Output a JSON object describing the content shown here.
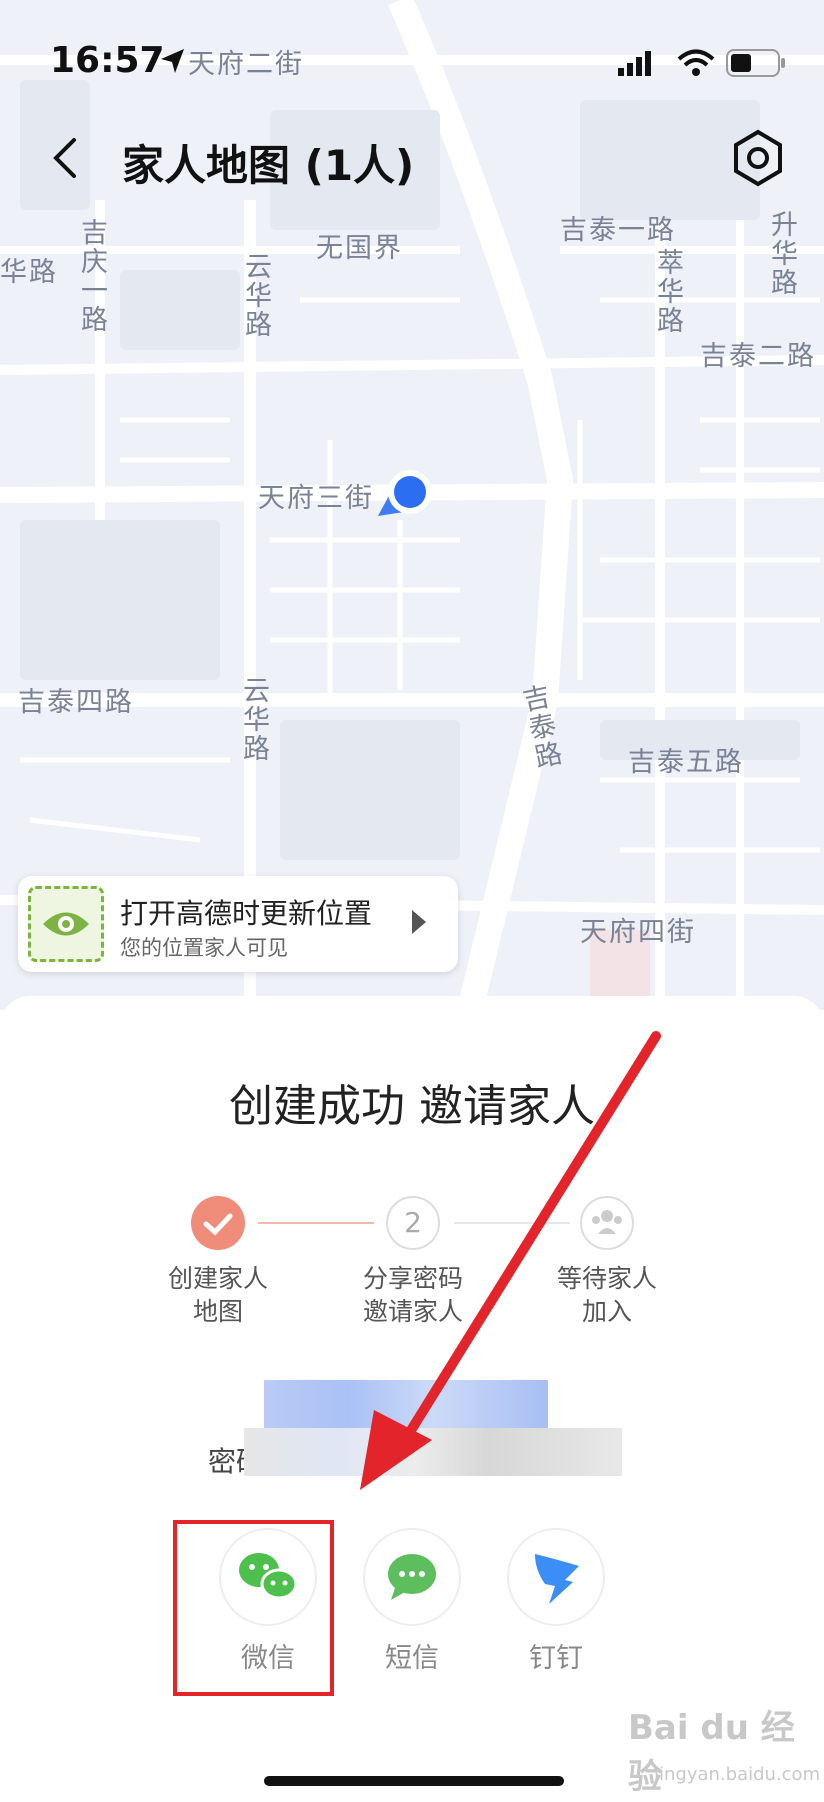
{
  "status_bar": {
    "time": "16:57"
  },
  "nav": {
    "title": "家人地图 (1人)"
  },
  "map": {
    "streets": [
      "天府二街",
      "无国界",
      "吉泰一路",
      "升华路",
      "吉庆一路",
      "云华路",
      "萃华路",
      "吉泰二路",
      "天府三街",
      "吉泰四路",
      "云华路",
      "吉泰路",
      "吉泰五路",
      "天府四街",
      "华路"
    ]
  },
  "location_card": {
    "title": "打开高德时更新位置",
    "subtitle": "您的位置家人可见"
  },
  "sheet": {
    "title": "创建成功 邀请家人",
    "steps": [
      {
        "number": "",
        "label_line1": "创建家人",
        "label_line2": "地图"
      },
      {
        "number": "2",
        "label_line1": "分享密码",
        "label_line2": "邀请家人"
      },
      {
        "number": "",
        "label_line1": "等待家人",
        "label_line2": "加入"
      }
    ],
    "password_label": "密码"
  },
  "share": {
    "wechat_label": "微信",
    "sms_label": "短信",
    "dingtalk_label": "钉钉"
  },
  "watermark": {
    "main": "Bai du 经验",
    "sub": "jingyan.baidu.com"
  },
  "colors": {
    "accent_blue": "#2b6ef2",
    "step_done": "#f08c7a",
    "wechat_green": "#4cbf4c",
    "dingtalk_blue": "#3a8ef6",
    "highlight_red": "#e3242b"
  }
}
